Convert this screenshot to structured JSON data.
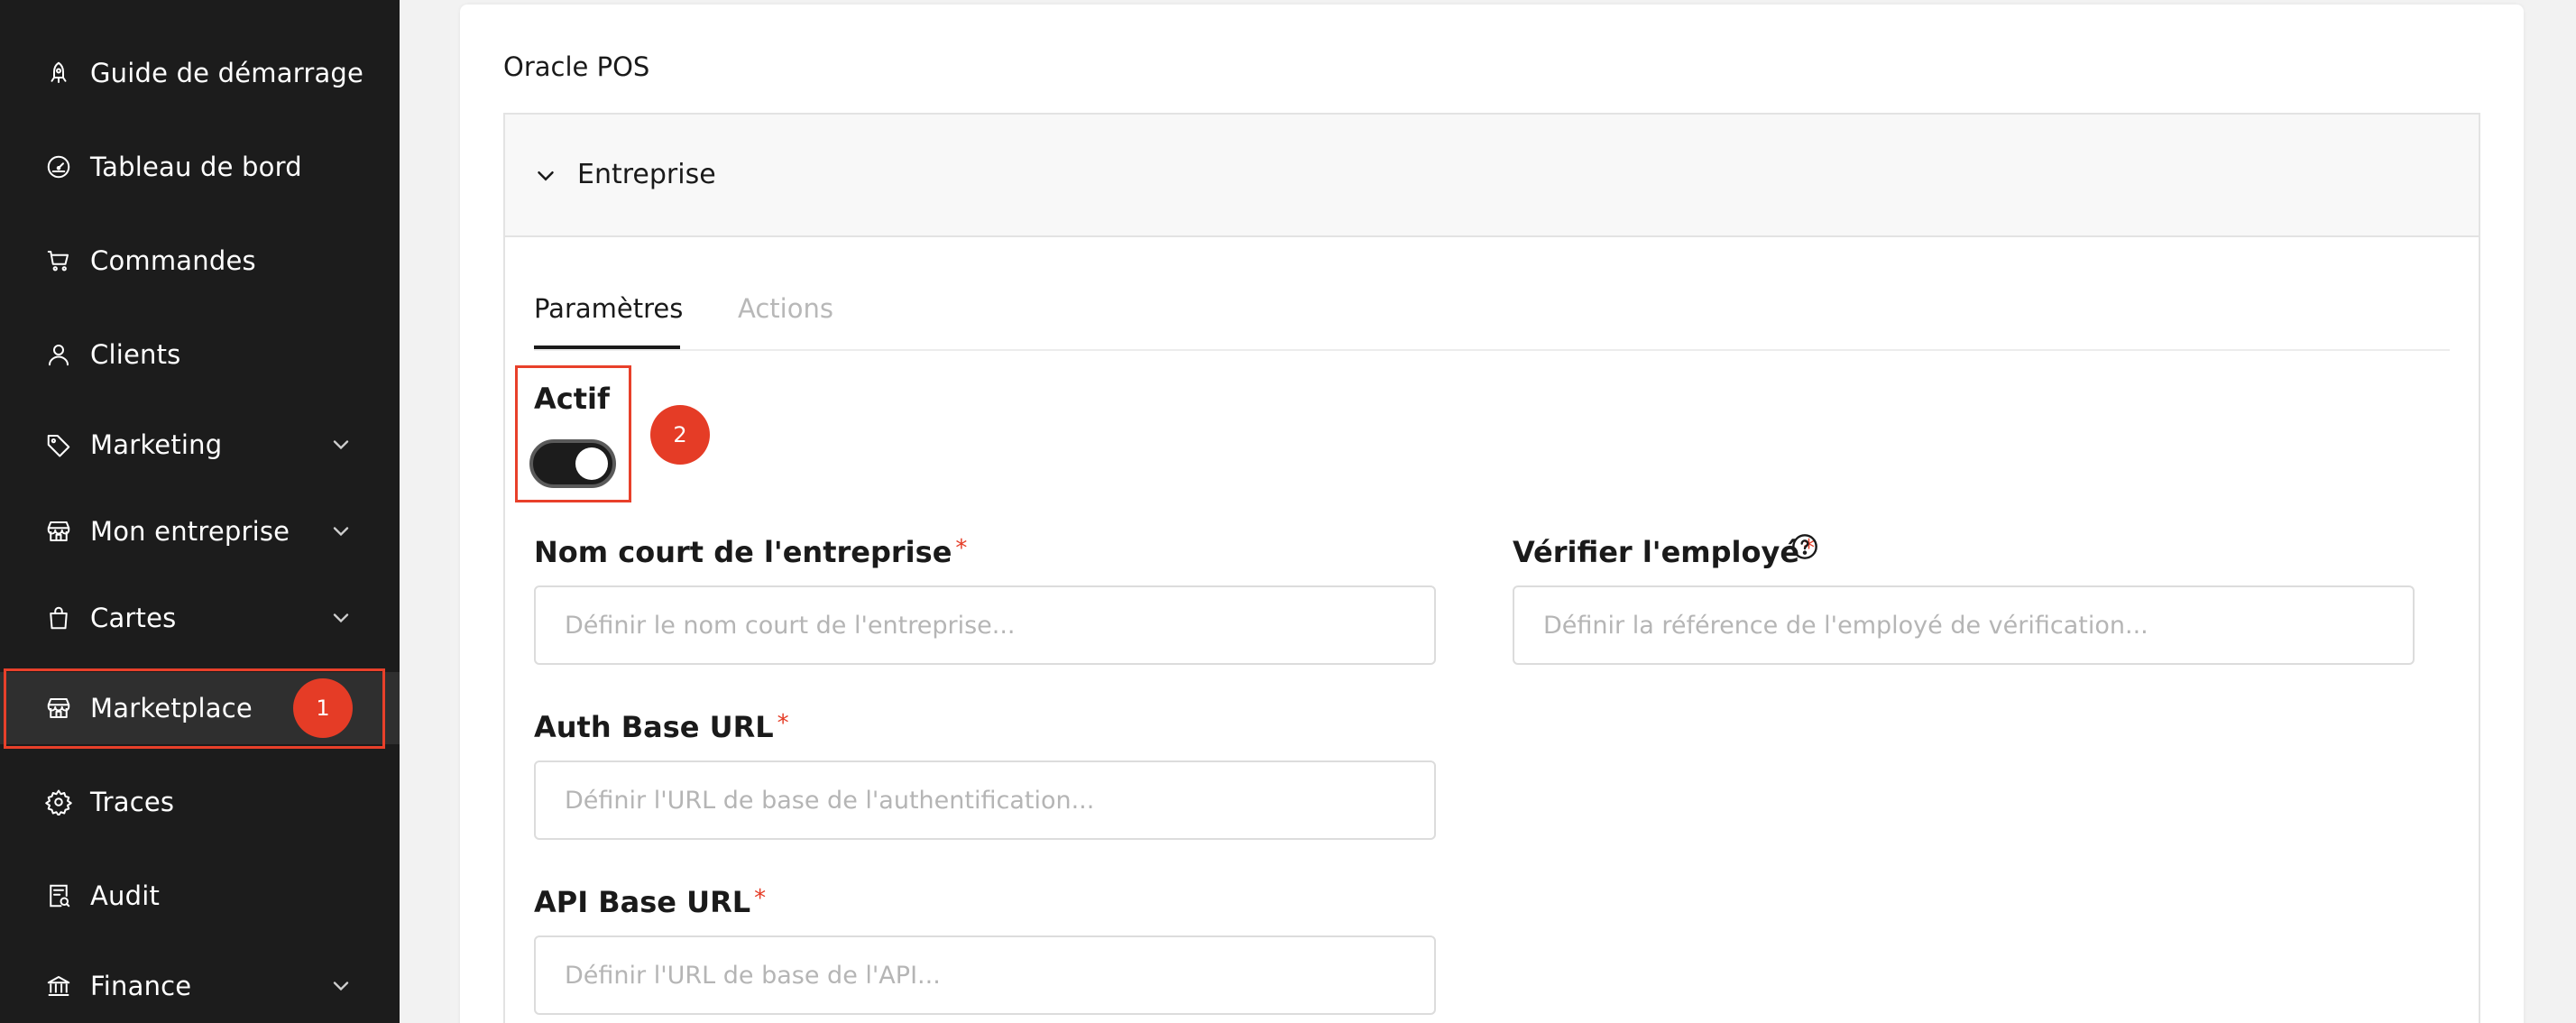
{
  "sidebar": {
    "items": [
      {
        "label": "Guide de démarrage",
        "icon": "rocket-icon",
        "has_chevron": false
      },
      {
        "label": "Tableau de bord",
        "icon": "gauge-icon",
        "has_chevron": false
      },
      {
        "label": "Commandes",
        "icon": "cart-icon",
        "has_chevron": false
      },
      {
        "label": "Clients",
        "icon": "user-icon",
        "has_chevron": false
      },
      {
        "label": "Marketing",
        "icon": "tag-icon",
        "has_chevron": true
      },
      {
        "label": "Mon entreprise",
        "icon": "store-icon",
        "has_chevron": true
      },
      {
        "label": "Cartes",
        "icon": "bag-icon",
        "has_chevron": true
      },
      {
        "label": "Marketplace",
        "icon": "store-icon",
        "has_chevron": false,
        "active": true
      },
      {
        "label": "Traces",
        "icon": "gear-icon",
        "has_chevron": false
      },
      {
        "label": "Audit",
        "icon": "audit-icon",
        "has_chevron": false
      },
      {
        "label": "Finance",
        "icon": "bank-icon",
        "has_chevron": true
      }
    ]
  },
  "annotations": {
    "badge_1": "1",
    "badge_2": "2"
  },
  "main": {
    "card_title": "Oracle POS",
    "section_label": "Entreprise",
    "tabs": [
      {
        "label": "Paramètres",
        "active": true
      },
      {
        "label": "Actions",
        "active": false
      }
    ],
    "active_label": "Actif",
    "active_toggle_on": true,
    "fields": {
      "short_name": {
        "label": "Nom court de l'entreprise",
        "required": "*",
        "placeholder": "Définir le nom court de l'entreprise...",
        "value": ""
      },
      "verify_employee": {
        "label": "Vérifier l'employé",
        "required": "*",
        "placeholder": "Définir la référence de l'employé de vérification...",
        "value": ""
      },
      "auth_base_url": {
        "label": "Auth Base URL",
        "required": "*",
        "placeholder": "Définir l'URL de base de l'authentification...",
        "value": ""
      },
      "api_base_url": {
        "label": "API Base URL",
        "required": "*",
        "placeholder": "Définir l'URL de base de l'API...",
        "value": ""
      }
    }
  },
  "colors": {
    "sidebar_bg": "#1c1c1c",
    "accent_red": "#e53c26",
    "toggle_on": "#1c1c1c"
  }
}
